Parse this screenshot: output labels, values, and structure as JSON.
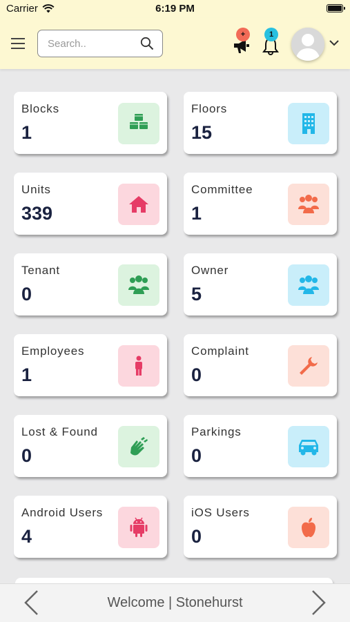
{
  "status_bar": {
    "carrier": "Carrier",
    "time": "6:19 PM"
  },
  "header": {
    "search_placeholder": "Search..",
    "announcement_badge": "+",
    "notification_badge": "1",
    "colors": {
      "header_bg": "#fdf8d2",
      "announcement_badge": "#f26b57",
      "notification_badge": "#27c0e0"
    }
  },
  "cards": [
    {
      "label": "Blocks",
      "value": "1",
      "icon": "cubes-icon",
      "icon_bg": "#dcf3df",
      "icon_color": "#2f9e55"
    },
    {
      "label": "Floors",
      "value": "15",
      "icon": "building-icon",
      "icon_bg": "#c9eefa",
      "icon_color": "#22b7e8"
    },
    {
      "label": "Units",
      "value": "339",
      "icon": "home-icon",
      "icon_bg": "#fcd7de",
      "icon_color": "#e63c66"
    },
    {
      "label": "Committee",
      "value": "1",
      "icon": "group-icon",
      "icon_bg": "#fde0d8",
      "icon_color": "#f26b4a"
    },
    {
      "label": "Tenant",
      "value": "0",
      "icon": "group-icon",
      "icon_bg": "#dcf3df",
      "icon_color": "#2f9e55"
    },
    {
      "label": "Owner",
      "value": "5",
      "icon": "group-icon",
      "icon_bg": "#c9eefa",
      "icon_color": "#22b7e8"
    },
    {
      "label": "Employees",
      "value": "1",
      "icon": "person-icon",
      "icon_bg": "#fcd7de",
      "icon_color": "#e63c66"
    },
    {
      "label": "Complaint",
      "value": "0",
      "icon": "wrench-icon",
      "icon_bg": "#fde0d8",
      "icon_color": "#f26b4a"
    },
    {
      "label": "Lost & Found",
      "value": "0",
      "icon": "hands-icon",
      "icon_bg": "#dcf3df",
      "icon_color": "#2f9e55"
    },
    {
      "label": "Parkings",
      "value": "0",
      "icon": "car-icon",
      "icon_bg": "#c9eefa",
      "icon_color": "#22b7e8"
    },
    {
      "label": "Android Users",
      "value": "4",
      "icon": "android-icon",
      "icon_bg": "#fcd7de",
      "icon_color": "#e63c66"
    },
    {
      "label": "iOS Users",
      "value": "0",
      "icon": "apple-icon",
      "icon_bg": "#fde0d8",
      "icon_color": "#f26b4a"
    }
  ],
  "footer": {
    "text": "Welcome | Stonehurst"
  }
}
